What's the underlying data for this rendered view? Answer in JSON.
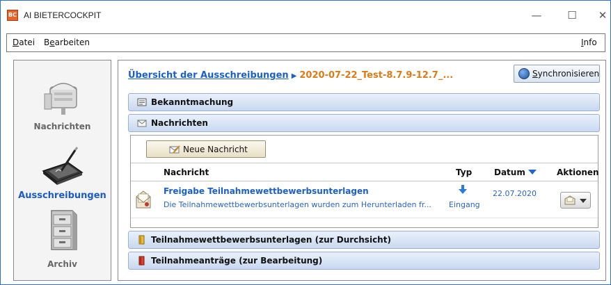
{
  "window": {
    "app_icon_text": "BC",
    "title": "AI BIETERCOCKPIT",
    "minimize_glyph": "—",
    "maximize_glyph": "☐",
    "close_glyph": "✕"
  },
  "menubar": {
    "datei_prefix": "D",
    "datei_rest": "atei",
    "bearbeiten_prefix": "B",
    "bearbeiten_underlined": "e",
    "bearbeiten_rest": "arbeiten",
    "info_prefix": "I",
    "info_rest": "nfo"
  },
  "sidebar": {
    "items": [
      {
        "label": "Nachrichten",
        "icon": "mailbox-icon",
        "active": false
      },
      {
        "label": "Ausschreibungen",
        "icon": "tablet-pen-icon",
        "active": true
      },
      {
        "label": "Archiv",
        "icon": "filing-cabinet-icon",
        "active": false
      }
    ]
  },
  "main": {
    "breadcrumb": {
      "link": "Übersicht der Ausschreibungen",
      "arrow": "▶",
      "current": "2020-07-22_Test-8.7.9-12.7_..."
    },
    "sync_button": {
      "prefix": "S",
      "rest": "ynchronisieren",
      "icon": "sync-globe-icon"
    },
    "sections": {
      "bekanntmachung": "Bekanntmachung",
      "nachrichten": "Nachrichten",
      "teilnahmewettbewerbsunterlagen": "Teilnahmewettbewerbsunterlagen (zur Durchsicht)",
      "teilnahmeantraege": "Teilnahmeanträge (zur Bearbeitung)"
    },
    "messages": {
      "new_button": "Neue Nachricht",
      "columns": {
        "nachricht": "Nachricht",
        "typ": "Typ",
        "datum": "Datum",
        "aktionen": "Aktionen"
      },
      "rows": [
        {
          "title": "Freigabe Teilnahmewettbewerbsunterlagen",
          "description": "Die Teilnahmewettbewerbsunterlagen wurden zum Herunterladen fr...",
          "type": "Eingang",
          "date": "22.07.2020"
        }
      ]
    }
  },
  "colors": {
    "accent_blue": "#1b60c9",
    "breadcrumb_orange": "#e07a14",
    "section_header": "#c8d8f0",
    "window_border": "#2a6fd6"
  }
}
